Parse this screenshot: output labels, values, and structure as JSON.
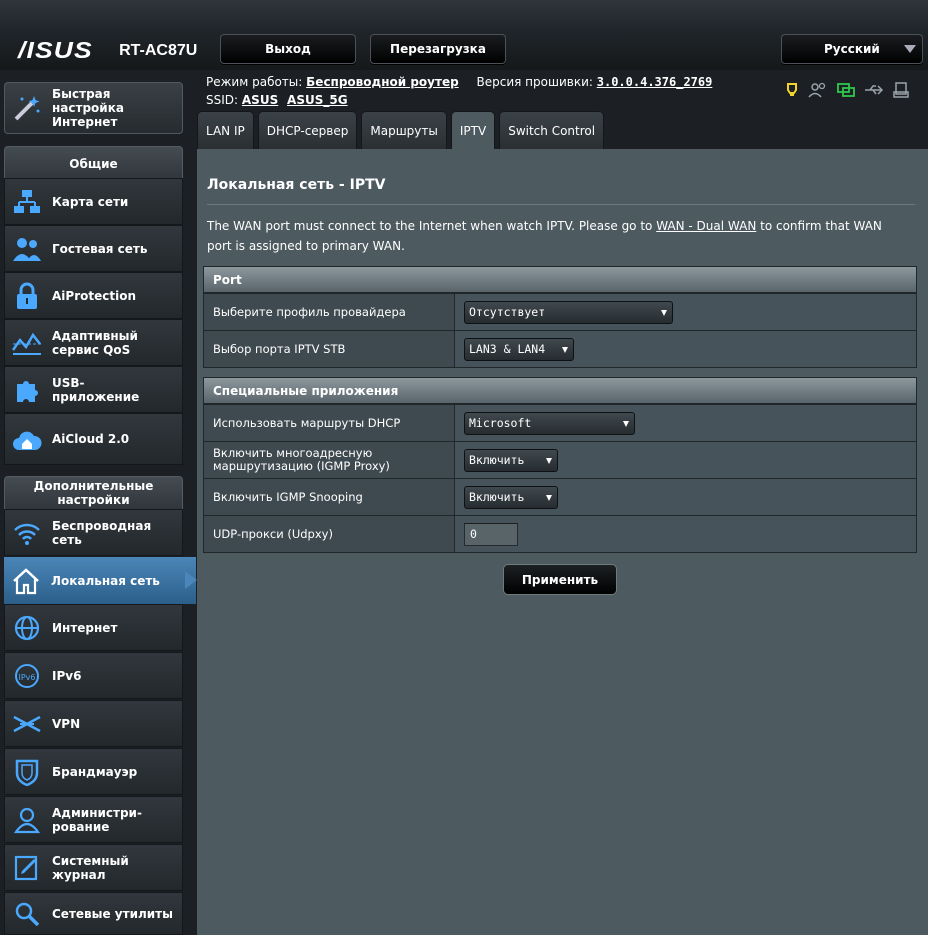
{
  "header": {
    "brand": "/ISUS",
    "model": "RT-AC87U",
    "logout_label": "Выход",
    "reboot_label": "Перезагрузка",
    "language": "Русский"
  },
  "status": {
    "mode_label": "Режим работы:",
    "mode_value": "Беспроводной роутер",
    "firmware_label": "Версия прошивки:",
    "firmware_value": "3.0.0.4.376_2769",
    "ssid_label": "SSID:",
    "ssid_1": "ASUS",
    "ssid_2": "ASUS_5G"
  },
  "sidebar": {
    "quick_setup": "Быстрая настройка Интернет",
    "general_head": "Общие",
    "general_items": [
      {
        "label": "Карта сети"
      },
      {
        "label": "Гостевая сеть"
      },
      {
        "label": "AiProtection"
      },
      {
        "label": "Адаптивный сервис QoS"
      },
      {
        "label": "USB-приложение"
      },
      {
        "label": "AiCloud 2.0"
      }
    ],
    "advanced_head": "Дополнительные настройки",
    "advanced_items": [
      {
        "label": "Беспроводная сеть"
      },
      {
        "label": "Локальная сеть"
      },
      {
        "label": "Интернет"
      },
      {
        "label": "IPv6"
      },
      {
        "label": "VPN"
      },
      {
        "label": "Брандмауэр"
      },
      {
        "label": "Администри-рование"
      },
      {
        "label": "Системный журнал"
      },
      {
        "label": "Сетевые утилиты"
      }
    ]
  },
  "tabs": [
    {
      "label": "LAN IP"
    },
    {
      "label": "DHCP-сервер"
    },
    {
      "label": "Маршруты"
    },
    {
      "label": "IPTV"
    },
    {
      "label": "Switch Control"
    }
  ],
  "content": {
    "title": "Локальная сеть - IPTV",
    "note_pre": "The WAN port must connect to the Internet when watch IPTV. Please go to ",
    "note_link": "WAN - Dual WAN",
    "note_post": " to confirm that WAN port is assigned to primary WAN.",
    "port_head": "Port",
    "port_rows": [
      {
        "label": "Выберите профиль провайдера",
        "value": "Отсутствует"
      },
      {
        "label": "Выбор порта IPTV STB",
        "value": "LAN3 & LAN4"
      }
    ],
    "special_head": "Специальные приложения",
    "special_rows": [
      {
        "label": "Использовать маршруты DHCP",
        "value": "Microsoft"
      },
      {
        "label": "Включить многоадресную маршрутизацию (IGMP Proxy)",
        "value": "Включить"
      },
      {
        "label": "Включить IGMP Snooping",
        "value": "Включить"
      },
      {
        "label": "UDP-прокси (Udpxy)",
        "value": "0"
      }
    ],
    "apply_label": "Применить"
  },
  "colors": {
    "accent_blue": "#4a86b9",
    "content_bg": "#4d5a60",
    "usb_green": "#2ec94a",
    "bulb_yellow": "#f2d32c"
  }
}
